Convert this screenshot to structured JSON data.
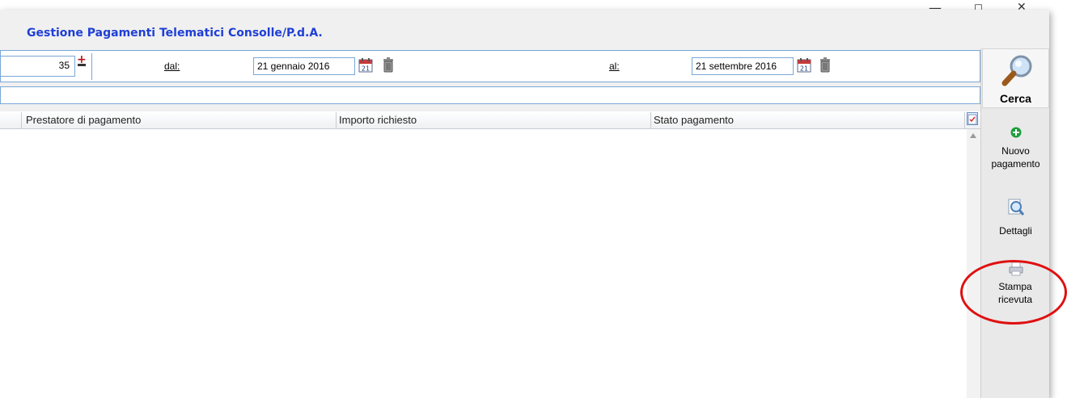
{
  "window": {
    "minimize_glyph": "—",
    "restore_glyph": "◻",
    "close_glyph": "✕"
  },
  "app": {
    "title": "Gestione Pagamenti Telematici Consolle/P.d.A."
  },
  "filter": {
    "count_value": "35",
    "from_label": "dal:",
    "from_date": "21 gennaio 2016",
    "to_label": "al:",
    "to_date": "21 settembre 2016",
    "calendar_day": "21"
  },
  "grid": {
    "columns": [
      "Prestatore di pagamento",
      "Importo richiesto",
      "Stato pagamento"
    ],
    "rows": []
  },
  "toolbar": {
    "search_label": "Cerca",
    "new_payment_label": "Nuovo pagamento",
    "details_label": "Dettagli",
    "print_receipt_label": "Stampa ricevuta"
  },
  "colors": {
    "title": "#1f3fd6",
    "border": "#7aa7d8",
    "highlight": "#e01010"
  }
}
